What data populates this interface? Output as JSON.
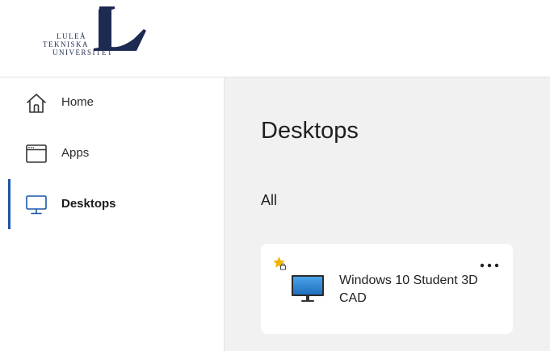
{
  "header": {
    "logo": {
      "line1": "LULEÅ",
      "line2": "TEKNISKA",
      "line3": "UNIVERSITET"
    }
  },
  "sidebar": {
    "items": [
      {
        "label": "Home",
        "icon": "home-icon"
      },
      {
        "label": "Apps",
        "icon": "window-icon"
      },
      {
        "label": "Desktops",
        "icon": "monitor-icon",
        "active": true
      }
    ]
  },
  "main": {
    "title": "Desktops",
    "section": "All",
    "desktops": [
      {
        "name": "Windows 10 Student 3D CAD",
        "favorite": true,
        "icon": "monitor-icon"
      }
    ]
  },
  "colors": {
    "accent": "#1a56a8",
    "logo": "#1d2b52",
    "favorite_star": "#f0b400",
    "main_bg": "#f1f1f1"
  }
}
